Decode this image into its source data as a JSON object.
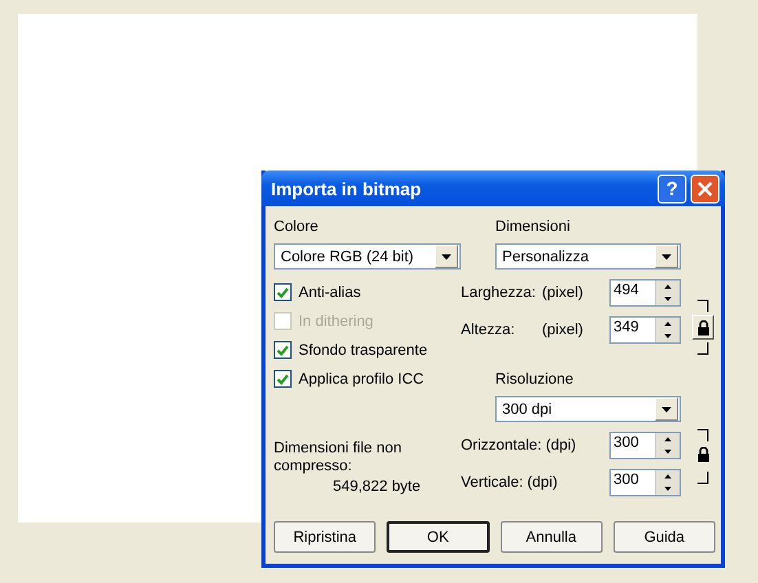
{
  "window": {
    "title": "Importa in bitmap",
    "help": "?"
  },
  "color": {
    "label": "Colore",
    "value": "Colore RGB (24 bit)"
  },
  "options": [
    {
      "label": "Anti-alias",
      "checked": true,
      "disabled": false
    },
    {
      "label": "In dithering",
      "checked": false,
      "disabled": true
    },
    {
      "label": "Sfondo trasparente",
      "checked": true,
      "disabled": false
    },
    {
      "label": "Applica profilo ICC",
      "checked": true,
      "disabled": false
    }
  ],
  "file_size": {
    "label": "Dimensioni file non compresso:",
    "value": "549,822 byte"
  },
  "dimensions": {
    "label": "Dimensioni",
    "value": "Personalizza",
    "rows": [
      {
        "label": "Larghezza:",
        "unit": "(pixel)",
        "value": "494"
      },
      {
        "label": "Altezza:",
        "unit": "(pixel)",
        "value": "349"
      }
    ]
  },
  "resolution": {
    "label": "Risoluzione",
    "value": "300 dpi",
    "rows": [
      {
        "label": "Orizzontale:",
        "unit": "(dpi)",
        "value": "300"
      },
      {
        "label": "Verticale:",
        "unit": "(dpi)",
        "value": "300"
      }
    ]
  },
  "buttons": [
    {
      "label": "Ripristina",
      "default": false
    },
    {
      "label": "OK",
      "default": true
    },
    {
      "label": "Annulla",
      "default": false
    },
    {
      "label": "Guida",
      "default": false
    }
  ]
}
